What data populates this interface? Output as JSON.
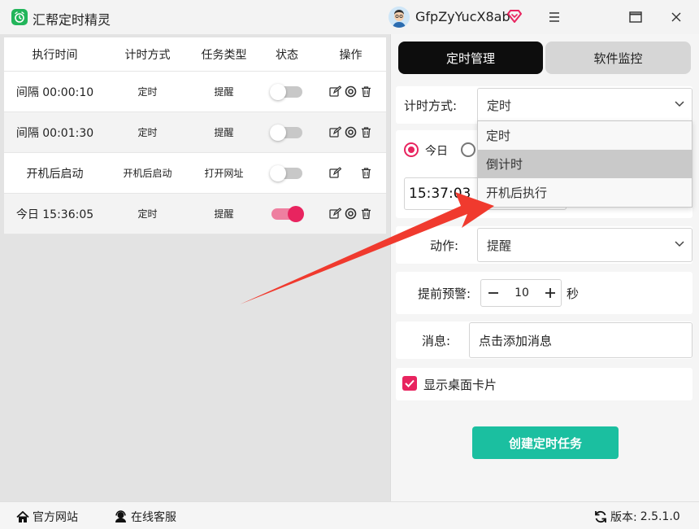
{
  "app": {
    "title": "汇帮定时精灵",
    "username": "GfpZyYucX8ab",
    "accent": "#e8245f",
    "brand_green": "#22b55a"
  },
  "table": {
    "headers": [
      "执行时间",
      "计时方式",
      "任务类型",
      "状态",
      "操作"
    ],
    "rows": [
      {
        "time": "间隔 00:00:10",
        "mode": "定时",
        "type": "提醒",
        "enabled": false,
        "ops": [
          "edit-icon",
          "target-icon",
          "trash-icon"
        ]
      },
      {
        "time": "间隔 00:01:30",
        "mode": "定时",
        "type": "提醒",
        "enabled": false,
        "ops": [
          "edit-icon",
          "target-icon",
          "trash-icon"
        ]
      },
      {
        "time": "开机后启动",
        "mode": "开机后启动",
        "type": "打开网址",
        "enabled": false,
        "ops": [
          "edit-icon",
          "trash-icon"
        ]
      },
      {
        "time": "今日 15:36:05",
        "mode": "定时",
        "type": "提醒",
        "enabled": true,
        "ops": [
          "edit-icon",
          "target-icon",
          "trash-icon"
        ]
      }
    ]
  },
  "tabs": {
    "active": "定时管理",
    "inactive": "软件监控"
  },
  "form": {
    "mode_label": "计时方式:",
    "mode_value": "定时",
    "radio_today": "今日",
    "time_value": "15:37:03",
    "action_label": "动作:",
    "action_value": "提醒",
    "warn_label": "提前预警:",
    "warn_value": "10",
    "warn_unit": "秒",
    "msg_label": "消息:",
    "msg_placeholder": "点击添加消息",
    "show_card_label": "显示桌面卡片",
    "create_button": "创建定时任务"
  },
  "dropdown": {
    "options": [
      "定时",
      "倒计时",
      "开机后执行"
    ],
    "highlighted_index": 1
  },
  "footer": {
    "website": "官方网站",
    "support": "在线客服",
    "version_label": "版本:",
    "version": "2.5.1.0"
  }
}
